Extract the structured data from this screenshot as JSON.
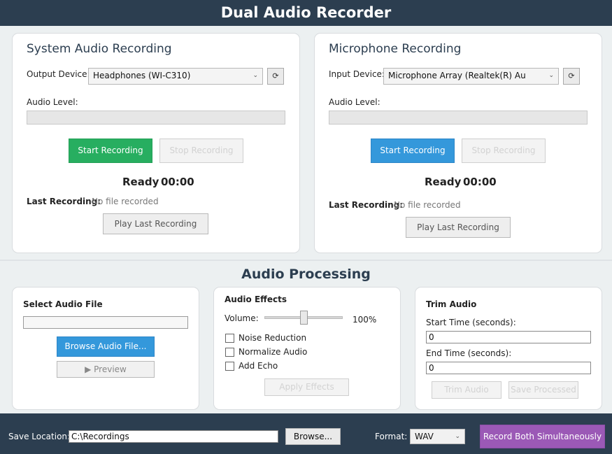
{
  "app": {
    "title": "Dual Audio Recorder"
  },
  "system": {
    "title": "System Audio Recording",
    "device_label": "Output Device:",
    "device_value": "Headphones (WI-C310)",
    "refresh_icon": "⟳",
    "level_label": "Audio Level:",
    "level": 0,
    "start_label": "Start Recording",
    "stop_label": "Stop Recording",
    "status": "Ready",
    "time": "00:00",
    "last_label": "Last Recording:",
    "last_value": "No file recorded",
    "play_label": "Play Last Recording"
  },
  "mic": {
    "title": "Microphone Recording",
    "device_label": "Input Device:",
    "device_value": "Microphone Array (Realtek(R) Au",
    "refresh_icon": "⟳",
    "level_label": "Audio Level:",
    "level": 0,
    "start_label": "Start Recording",
    "stop_label": "Stop Recording",
    "status": "Ready",
    "time": "00:00",
    "last_label": "Last Recording:",
    "last_value": "No file recorded",
    "play_label": "Play Last Recording"
  },
  "processing": {
    "title": "Audio Processing",
    "select_file": {
      "title": "Select Audio File",
      "path_value": "",
      "browse_label": "Browse Audio File...",
      "preview_label": "▶ Preview"
    },
    "effects": {
      "title": "Audio Effects",
      "volume_label": "Volume:",
      "volume_value": "100%",
      "volume_fraction": 0.5,
      "noise_label": "Noise Reduction",
      "normalize_label": "Normalize Audio",
      "echo_label": "Add Echo",
      "apply_label": "Apply Effects"
    },
    "trim": {
      "title": "Trim Audio",
      "start_label": "Start Time (seconds):",
      "start_value": "0",
      "end_label": "End Time (seconds):",
      "end_value": "0",
      "trim_label": "Trim Audio",
      "save_label": "Save Processed"
    }
  },
  "footer": {
    "save_location_label": "Save Location:",
    "save_location_value": "C:\\Recordings",
    "browse_label": "Browse...",
    "format_label": "Format:",
    "format_value": "WAV",
    "record_both_label": "Record Both Simultaneously"
  },
  "colors": {
    "header": "#2c3e50",
    "green": "#27ae60",
    "blue": "#3498db",
    "purple": "#9b59b6"
  }
}
